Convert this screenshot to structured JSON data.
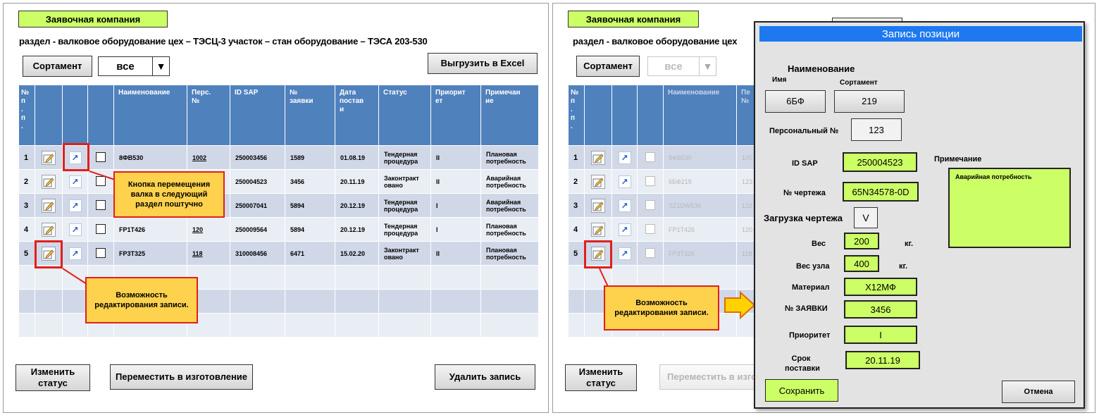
{
  "left": {
    "company_label": "Заявочная компания",
    "info_line": "раздел - валковое оборудование   цех – ТЭСЦ-3   участок – стан   оборудование – ТЭСА 203-530",
    "sortament_label": "Сортамент",
    "filter_value": "все",
    "export_label": "Выгрузить в Excel",
    "table": {
      "headers": [
        "№ п . п .",
        "",
        "",
        "",
        "Наименование",
        "Перс. №",
        "ID SAP",
        "№ заявки",
        "Дата поставки",
        "Статус",
        "Приоритет",
        "Примечание"
      ],
      "header_display": [
        "№\nп\n.\nп\n.",
        "",
        "",
        "",
        "Наименование",
        "Перс.\n№",
        "ID SAP",
        "№\nзаявки",
        "Дата\nпостав\nи",
        "Статус",
        "Приорит\nет",
        "Примечан\nие"
      ],
      "rows": [
        {
          "n": "1",
          "name": "8ФВ530",
          "pers": "1002",
          "sap": "250003456",
          "req": "1589",
          "date": "01.08.19",
          "status": "Тендерная процедура",
          "prio": "II",
          "note": "Плановая потребность"
        },
        {
          "n": "2",
          "name": "",
          "pers": "",
          "sap": "250004523",
          "req": "3456",
          "date": "20.11.19",
          "status": "Законтракт овано",
          "prio": "II",
          "note": "Аварийная потребность"
        },
        {
          "n": "3",
          "name": "",
          "pers": "",
          "sap": "250007041",
          "req": "5894",
          "date": "20.12.19",
          "status": "Тендерная процедура",
          "prio": "I",
          "note": "Аварийная потребность"
        },
        {
          "n": "4",
          "name": "FP1T426",
          "pers": "120",
          "sap": "250009564",
          "req": "5894",
          "date": "20.12.19",
          "status": "Тендерная процедура",
          "prio": "I",
          "note": "Плановая потребность"
        },
        {
          "n": "5",
          "name": "FP3T325",
          "pers": "118",
          "sap": "310008456",
          "req": "6471",
          "date": "15.02.20",
          "status": "Законтракт овано",
          "prio": "II",
          "note": "Плановая потребность"
        }
      ]
    },
    "callout_move": "Кнопка перемещения валка в следующий раздел поштучно",
    "callout_edit": "Возможность редактирования записи.",
    "btn_change_status": "Изменить статус",
    "btn_move_production": "Переместить в изготовление",
    "btn_delete": "Удалить запись"
  },
  "right": {
    "company_label": "Заявочная компания",
    "info_line": "раздел - валковое оборудование   цех",
    "sortament_label": "Сортамент",
    "filter_value": "все",
    "table": {
      "header_display": [
        "№\nп\n.\nп\n.",
        "",
        "",
        "",
        "Наименование",
        "Пе\n№"
      ],
      "rows": [
        {
          "n": "1",
          "name": "8ФВ530",
          "pers": "100"
        },
        {
          "n": "2",
          "name": "6БФ219",
          "pers": "123"
        },
        {
          "n": "3",
          "name": "SZ1DW530",
          "pers": "122"
        },
        {
          "n": "4",
          "name": "FP1T426",
          "pers": "120"
        },
        {
          "n": "5",
          "name": "FP3T325",
          "pers": "118"
        }
      ]
    },
    "callout_edit": "Возможность редактирования записи.",
    "btn_change_status": "Изменить статус",
    "btn_move_production": "Переместить в изгот"
  },
  "dialog": {
    "title": "Запись позиции",
    "name_label": "Наименование",
    "imya_label": "Имя",
    "sortament_label": "Сортамент",
    "name_value": "6БФ",
    "sortament_value": "219",
    "personal_label": "Персональный №",
    "personal_value": "123",
    "idsap_label": "ID SAP",
    "idsap_value": "250004523",
    "drawing_no_label": "№ чертежа",
    "drawing_no_value": "65N34578-0D",
    "drawing_upload_label": "Загрузка чертежа",
    "drawing_upload_value": "V",
    "weight_label": "Вес",
    "weight_value": "200",
    "weight_unit": "кг.",
    "node_weight_label": "Вес узла",
    "node_weight_value": "400",
    "node_weight_unit": "кг.",
    "material_label": "Материал",
    "material_value": "Х12МФ",
    "request_label": "№ ЗАЯВКИ",
    "request_value": "3456",
    "priority_label": "Приоритет",
    "priority_value": "I",
    "delivery_label": "Срок поставки",
    "delivery_value": "20.11.19",
    "note_label": "Примечание",
    "note_value": "Аварийная потребность",
    "save_label": "Сохранить",
    "cancel_label": "Отмена"
  }
}
